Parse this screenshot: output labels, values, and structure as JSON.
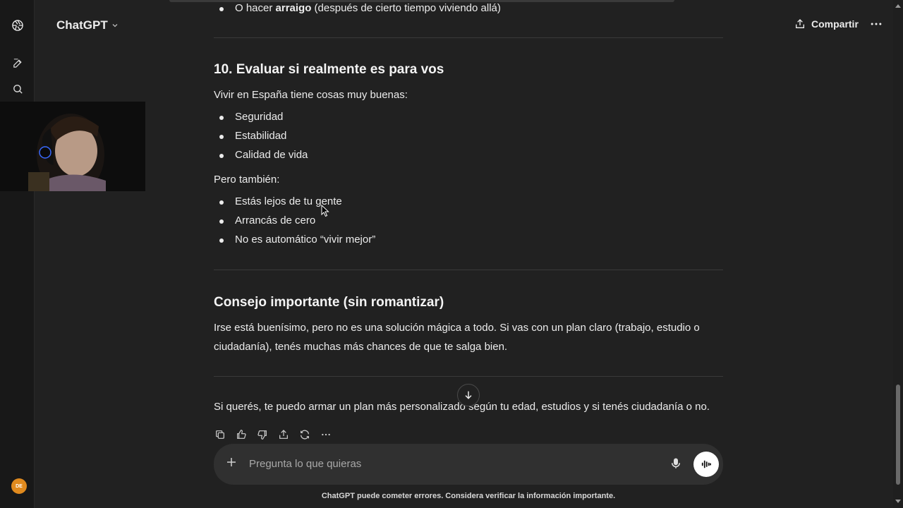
{
  "header": {
    "app_title": "ChatGPT",
    "share_label": "Compartir"
  },
  "sidebar": {
    "avatar_initials": "DE"
  },
  "message": {
    "prev_bullet_prefix": "O hacer ",
    "prev_bullet_bold": "arraigo",
    "prev_bullet_suffix": " (después de cierto tiempo viviendo allá)",
    "section10_title": "10. Evaluar si realmente es para vos",
    "section10_intro": "Vivir en España tiene cosas muy buenas:",
    "pros": [
      "Seguridad",
      "Estabilidad",
      "Calidad de vida"
    ],
    "cons_intro": "Pero también:",
    "cons": [
      "Estás lejos de tu gente",
      "Arrancás de cero",
      "No es automático “vivir mejor”"
    ],
    "advice_title": "Consejo importante (sin romantizar)",
    "advice_text": "Irse está buenísimo, pero no es una solución mágica a todo. Si vas con un plan claro (trabajo, estudio o ciudadanía), tenés muchas más chances de que te salga bien.",
    "closing": "Si querés, te puedo armar un plan más personalizado según tu edad, estudios y si tenés ciudadanía o no."
  },
  "composer": {
    "placeholder": "Pregunta lo que quieras"
  },
  "footer": {
    "disclaimer": "ChatGPT puede cometer errores. Considera verificar la información importante."
  },
  "icons": {
    "logo": "openai-logo-icon",
    "new_chat": "edit-icon",
    "search": "search-icon",
    "share": "share-icon",
    "more": "ellipsis-icon",
    "copy": "copy-icon",
    "thumbs_up": "thumbs-up-icon",
    "thumbs_down": "thumbs-down-icon",
    "upload": "share-icon",
    "regenerate": "refresh-icon",
    "scroll_down": "arrow-down-icon",
    "plus": "plus-icon",
    "mic": "mic-icon",
    "voice": "voice-wave-icon"
  },
  "colors": {
    "background": "#212121",
    "sidebar": "#181818",
    "composer": "#303030",
    "avatar": "#e08a1e"
  }
}
